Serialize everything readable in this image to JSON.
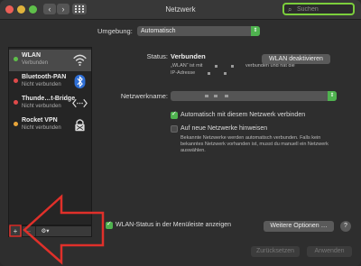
{
  "window": {
    "title": "Netzwerk",
    "search_placeholder": "Suchen",
    "nav_back": "‹",
    "nav_forward": "›"
  },
  "location": {
    "label": "Umgebung:",
    "value": "Automatisch"
  },
  "services": [
    {
      "name": "WLAN",
      "status": "Verbunden",
      "dot_color": "#5fc04a",
      "icon": "wifi-icon"
    },
    {
      "name": "Bluetooth-PAN",
      "status": "Nicht verbunden",
      "dot_color": "#e04a4a",
      "icon": "bluetooth-icon"
    },
    {
      "name": "Thunde…t-Bridge",
      "status": "Nicht verbunden",
      "dot_color": "#e04a4a",
      "icon": "thunderbolt-bridge-icon"
    },
    {
      "name": "Rocket VPN",
      "status": "Nicht verbunden",
      "dot_color": "#e8a53a",
      "icon": "lock-icon"
    }
  ],
  "sidebar_buttons": {
    "add": "+",
    "remove": "−",
    "gear": "⚙▾"
  },
  "detail": {
    "status_label": "Status:",
    "status_value": "Verbunden",
    "status_desc_1": "„WLAN“ ist mit",
    "status_desc_2": "verbunden und hat die",
    "status_desc_3": "IP-Adresse",
    "deactivate_button": "WLAN deaktivieren",
    "network_name_label": "Netzwerkname:",
    "auto_join_label": "Automatisch mit diesem Netzwerk verbinden",
    "auto_join_checked": true,
    "ask_new_label": "Auf neue Netzwerke hinweisen",
    "ask_new_checked": false,
    "ask_new_desc_1": "Bekannte Netzwerke werden automatisch verbunden. Falls kein",
    "ask_new_desc_2": "bekanntes Netzwerk vorhanden ist, musst du manuell ein Netzwerk",
    "ask_new_desc_3": "auswählen."
  },
  "footer": {
    "menubar_label": "WLAN-Status in der Menüleiste anzeigen",
    "menubar_checked": true,
    "advanced_button": "Weitere Optionen …",
    "help_button": "?",
    "revert_button": "Zurücksetzen",
    "apply_button": "Anwenden"
  },
  "colors": {
    "accent": "#4fb34f",
    "annotation_arrow": "#e0302a"
  }
}
